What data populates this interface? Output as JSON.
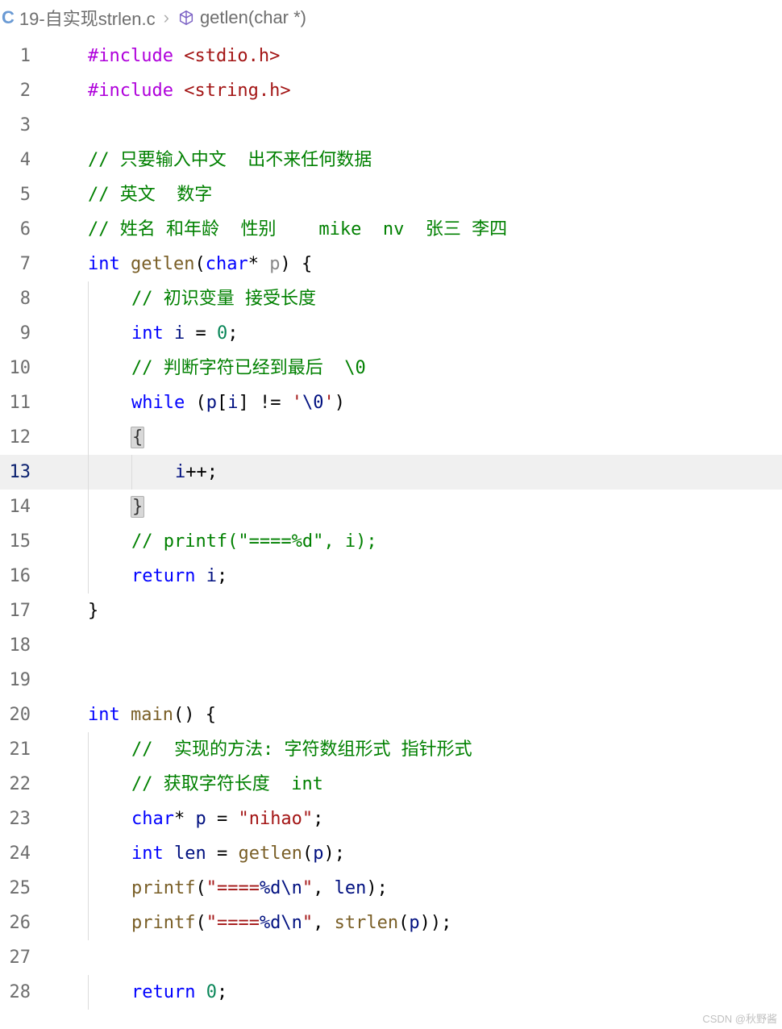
{
  "breadcrumb": {
    "file_icon": "C",
    "file": "19-自实现strlen.c",
    "sep": "›",
    "symbol_icon": "cube-icon",
    "symbol": "getlen(char *)"
  },
  "gutter": {
    "1": "1",
    "2": "2",
    "3": "3",
    "4": "4",
    "5": "5",
    "6": "6",
    "7": "7",
    "8": "8",
    "9": "9",
    "10": "10",
    "11": "11",
    "12": "12",
    "13": "13",
    "14": "14",
    "15": "15",
    "16": "16",
    "17": "17",
    "18": "18",
    "19": "19",
    "20": "20",
    "21": "21",
    "22": "22",
    "23": "23",
    "24": "24",
    "25": "25",
    "26": "26",
    "27": "27",
    "28": "28"
  },
  "code": {
    "l1": {
      "prep": "#include",
      "sp": " ",
      "inc": "<stdio.h>"
    },
    "l2": {
      "prep": "#include",
      "sp": " ",
      "inc": "<string.h>"
    },
    "l3": {
      "text": ""
    },
    "l4": {
      "comment": "// 只要输入中文  出不来任何数据"
    },
    "l5": {
      "comment": "// 英文  数字"
    },
    "l6": {
      "comment": "// 姓名 和年龄  性别    mike  nv  张三 李四"
    },
    "l7": {
      "kw": "int",
      "sp1": " ",
      "fn": "getlen",
      "lp": "(",
      "ty": "char",
      "star": "*",
      "sp2": " ",
      "param": "p",
      "rp": ")",
      "sp3": " ",
      "br": "{"
    },
    "l8": {
      "comment": "// 初识变量 接受长度"
    },
    "l9": {
      "ty": "int",
      "sp": " ",
      "var": "i",
      "sp2": " ",
      "op": "=",
      "sp3": " ",
      "num": "0",
      "sc": ";"
    },
    "l10": {
      "comment": "// 判断字符已经到最后  \\0"
    },
    "l11": {
      "kw": "while",
      "sp": " ",
      "lp": "(",
      "var": "p",
      "lb": "[",
      "idx": "i",
      "rb": "]",
      "sp2": " ",
      "op": "!=",
      "sp3": " ",
      "q1": "'",
      "esc": "\\0",
      "q2": "'",
      "rp": ")"
    },
    "l12": {
      "br": "{"
    },
    "l13": {
      "var": "i",
      "op": "++",
      "sc": ";"
    },
    "l14": {
      "br": "}"
    },
    "l15": {
      "comment": "// printf(\"====%d\", i);"
    },
    "l16": {
      "kw": "return",
      "sp": " ",
      "var": "i",
      "sc": ";"
    },
    "l17": {
      "br": "}"
    },
    "l18": {
      "text": ""
    },
    "l19": {
      "text": ""
    },
    "l20": {
      "kw": "int",
      "sp": " ",
      "fn": "main",
      "lp": "(",
      "rp": ")",
      "sp2": " ",
      "br": "{"
    },
    "l21": {
      "comment": "//  实现的方法: 字符数组形式 指针形式"
    },
    "l22": {
      "comment": "// 获取字符长度  int"
    },
    "l23": {
      "ty": "char",
      "star": "*",
      "sp": " ",
      "var": "p",
      "sp2": " ",
      "op": "=",
      "sp3": " ",
      "str": "\"nihao\"",
      "sc": ";"
    },
    "l24": {
      "ty": "int",
      "sp": " ",
      "var": "len",
      "sp2": " ",
      "op": "=",
      "sp3": " ",
      "fn": "getlen",
      "lp": "(",
      "arg": "p",
      "rp": ")",
      "sc": ";"
    },
    "l25": {
      "fn": "printf",
      "lp": "(",
      "q": "\"",
      "s1": "====",
      "esc": "%d\\n",
      "q2": "\"",
      "cm": ",",
      "sp": " ",
      "arg": "len",
      "rp": ")",
      "sc": ";"
    },
    "l26": {
      "fn": "printf",
      "lp": "(",
      "q": "\"",
      "s1": "====",
      "esc": "%d\\n",
      "q2": "\"",
      "cm": ",",
      "sp": " ",
      "fn2": "strlen",
      "lp2": "(",
      "arg": "p",
      "rp2": ")",
      "rp": ")",
      "sc": ";"
    },
    "l27": {
      "text": ""
    },
    "l28": {
      "kw": "return",
      "sp": " ",
      "num": "0",
      "sc": ";"
    }
  },
  "editor": {
    "indent": "    ",
    "indent2": "        ",
    "indent3": "            "
  },
  "watermark": "CSDN @秋野酱"
}
